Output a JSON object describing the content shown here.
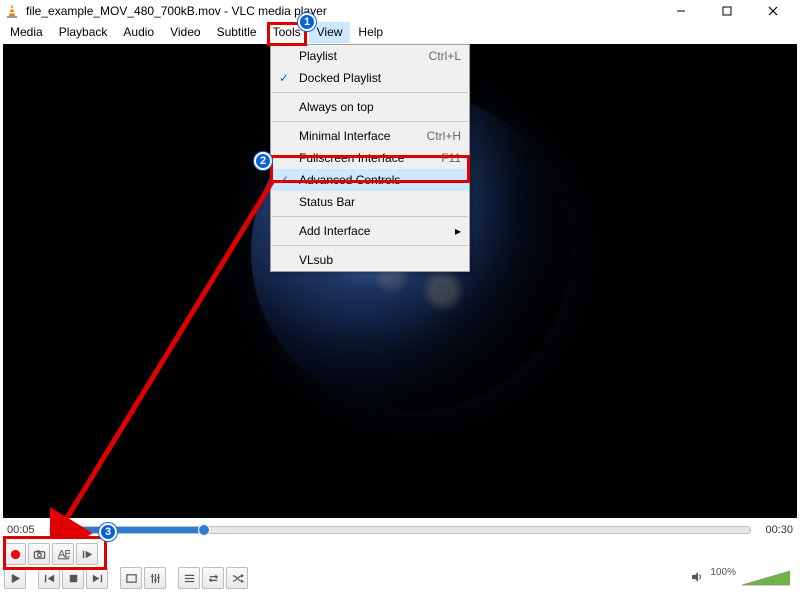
{
  "window": {
    "title": "file_example_MOV_480_700kB.mov - VLC media player"
  },
  "menubar": {
    "items": [
      "Media",
      "Playback",
      "Audio",
      "Video",
      "Subtitle",
      "Tools",
      "View",
      "Help"
    ],
    "open_index": 6
  },
  "view_menu": {
    "items": [
      {
        "label": "Playlist",
        "accel": "Ctrl+L",
        "checked": false
      },
      {
        "label": "Docked Playlist",
        "accel": "",
        "checked": true
      },
      {
        "sep": true
      },
      {
        "label": "Always on top",
        "accel": "",
        "checked": false
      },
      {
        "sep": true
      },
      {
        "label": "Minimal Interface",
        "accel": "Ctrl+H",
        "checked": false
      },
      {
        "label": "Fullscreen Interface",
        "accel": "F11",
        "checked": false
      },
      {
        "label": "Advanced Controls",
        "accel": "",
        "checked": true,
        "highlight": true
      },
      {
        "label": "Status Bar",
        "accel": "",
        "checked": false
      },
      {
        "sep": true
      },
      {
        "label": "Add Interface",
        "accel": "",
        "submenu": true
      },
      {
        "sep": true
      },
      {
        "label": "VLsub",
        "accel": "",
        "checked": false
      }
    ]
  },
  "playback": {
    "elapsed": "00:05",
    "total": "00:30"
  },
  "advanced_controls": {
    "record": "record-icon",
    "snapshot": "camera-icon",
    "loop": "loop-ab-icon",
    "frame": "frame-step-icon"
  },
  "main_controls": {
    "play": "play-icon",
    "prev": "skip-prev-icon",
    "stop": "stop-icon",
    "next": "skip-next-icon",
    "fullscreen": "fullscreen-icon",
    "ext": "extended-settings-icon",
    "playlist": "playlist-icon",
    "loop": "loop-icon",
    "shuffle": "shuffle-icon"
  },
  "volume": {
    "percent": "100%",
    "mute_icon": "speaker-icon"
  },
  "annotations": {
    "c1": "1",
    "c2": "2",
    "c3": "3"
  }
}
